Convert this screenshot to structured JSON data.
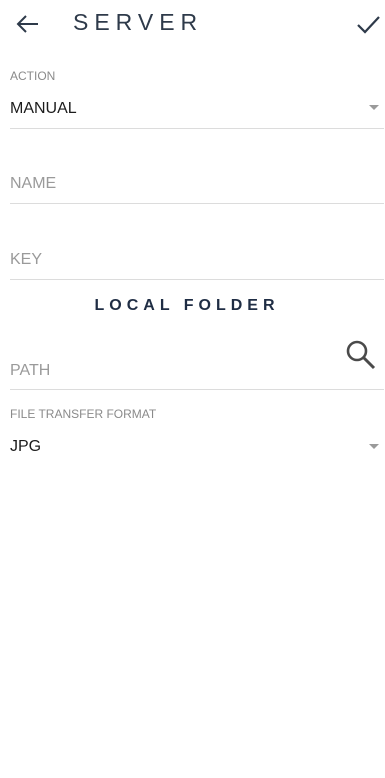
{
  "toolbar": {
    "title": "SERVER",
    "back_icon": "arrow-left-icon",
    "confirm_icon": "checkmark-icon"
  },
  "action": {
    "label": "ACTION",
    "value": "MANUAL"
  },
  "name_field": {
    "placeholder": "NAME"
  },
  "key_field": {
    "placeholder": "KEY"
  },
  "local_folder": {
    "heading": "LOCAL FOLDER",
    "path_placeholder": "PATH",
    "search_icon": "search-icon"
  },
  "file_transfer_format": {
    "label": "FILE TRANSFER FORMAT",
    "value": "JPG"
  },
  "colors": {
    "title_text": "#2e3a4a",
    "heading_text": "#1f2d44",
    "divider": "#dcdcdc",
    "hint_text": "#9a9a9a"
  }
}
